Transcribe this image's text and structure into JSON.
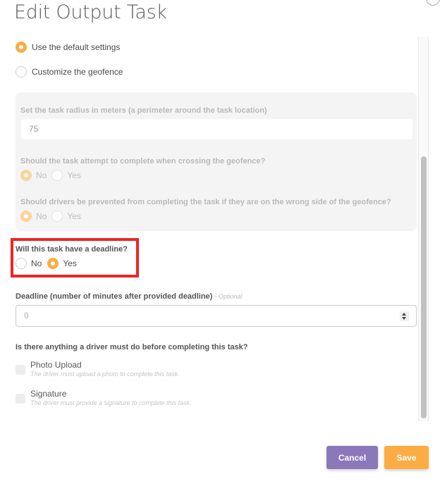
{
  "dialog": {
    "title": "Edit Output Task"
  },
  "geofence_mode": {
    "options": [
      {
        "label": "Use the default settings",
        "checked": true
      },
      {
        "label": "Customize the geofence",
        "checked": false
      }
    ]
  },
  "geofence_panel": {
    "radius_label": "Set the task radius in meters (a perimeter around the task location)",
    "radius_value": "75",
    "crossing_question": "Should the task attempt to complete when crossing the geofence?",
    "crossing_options": [
      {
        "label": "No",
        "checked": true
      },
      {
        "label": "Yes",
        "checked": false
      }
    ],
    "wrong_side_question": "Should drivers be prevented from completing the task if they are on the wrong side of the geofence?",
    "wrong_side_options": [
      {
        "label": "No",
        "checked": true
      },
      {
        "label": "Yes",
        "checked": false
      }
    ]
  },
  "deadline": {
    "question": "Will this task have a deadline?",
    "options": [
      {
        "label": "No",
        "checked": false
      },
      {
        "label": "Yes",
        "checked": true
      }
    ],
    "highlight_color": "#ee2525"
  },
  "deadline_minutes": {
    "label": "Deadline (number of minutes after provided deadline)",
    "optional_tag": "- Optional",
    "placeholder": "0"
  },
  "requirements": {
    "question": "Is there anything a driver must do before completing this task?",
    "items": [
      {
        "title": "Photo Upload",
        "description": "The driver must upload a photo to complete this task.",
        "checked": false
      },
      {
        "title": "Signature",
        "description": "The driver must provide a signature to complete this task.",
        "checked": false
      }
    ]
  },
  "footer": {
    "cancel_label": "Cancel",
    "save_label": "Save"
  },
  "colors": {
    "accent": "#fbad43",
    "cancel": "#8a78ba"
  }
}
